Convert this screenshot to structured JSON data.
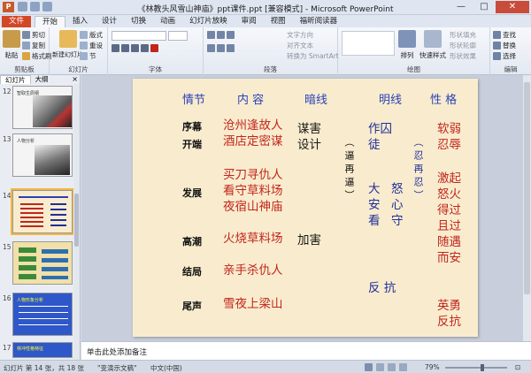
{
  "window": {
    "title": "《林教头风雪山神庙》ppt课件.ppt [兼容模式] - Microsoft PowerPoint",
    "buttons": [
      "—",
      "□",
      "✕"
    ]
  },
  "tabs": [
    "文件",
    "开始",
    "插入",
    "设计",
    "切换",
    "动画",
    "幻灯片放映",
    "审阅",
    "视图",
    "福昕阅读器"
  ],
  "ribbon": {
    "clipboard": {
      "paste": "粘贴",
      "cut": "剪切",
      "copy": "复制",
      "format_painter": "格式刷",
      "label": "剪贴板"
    },
    "slides": {
      "new_slide": "新建幻灯片",
      "layout": "版式",
      "reset": "重设",
      "section": "节",
      "label": "幻灯片"
    },
    "font": {
      "label": "字体"
    },
    "paragraph": {
      "text_direction": "文字方向",
      "align_text": "对齐文本",
      "smartart": "转换为 SmartArt",
      "label": "段落"
    },
    "drawing": {
      "arrange": "排列",
      "quick_styles": "快速样式",
      "shape_fill": "形状填充",
      "shape_outline": "形状轮廓",
      "shape_effects": "形状效果",
      "label": "绘图"
    },
    "editing": {
      "find": "查找",
      "replace": "替换",
      "select": "选择",
      "label": "编辑"
    }
  },
  "left_panel": {
    "tabs": [
      "幻灯片",
      "大纲"
    ],
    "close": "×",
    "slide_numbers": [
      "12",
      "13",
      "14",
      "15",
      "16",
      "17"
    ],
    "thumb_texts": {
      "t12": "智取生辰纲",
      "t13": "人物分析",
      "t16": "人物形象分析",
      "t17": "林冲性格特征"
    },
    "selected": "14"
  },
  "slide": {
    "headers": [
      "情节",
      "内 容",
      "暗线",
      "明线",
      "性 格"
    ],
    "rows": [
      {
        "label": "序幕",
        "content": [
          "沧州逢故人"
        ]
      },
      {
        "label": "开端",
        "content": [
          "酒店定密谋"
        ]
      },
      {
        "label": "发展",
        "content": [
          "买刀寻仇人",
          "看守草料场",
          "夜宿山神庙"
        ]
      },
      {
        "label": "高潮",
        "content": [
          "火烧草料场"
        ]
      },
      {
        "label": "结局",
        "content": [
          "亲手杀仇人"
        ]
      },
      {
        "label": "尾声",
        "content": [
          "雪夜上梁山"
        ]
      }
    ],
    "dark_line": {
      "plot": "谋害",
      "plan": "设计",
      "add_harm": "加害",
      "vertical": "（逼再逼）"
    },
    "bright_line": {
      "prisoner": "作囚",
      "follower": "徒",
      "settle": "大安看",
      "anger": "怒心守",
      "vertical": "（忍再忍）",
      "resist": "反 抗"
    },
    "character": {
      "weak": "软弱",
      "humble": "忍辱",
      "rise": [
        "激起",
        "怒火",
        "得过",
        "且过",
        "随遇",
        "而安"
      ],
      "brave": "英勇",
      "resist": "反抗"
    }
  },
  "notes": "单击此处添加备注",
  "status": {
    "slide": "幻灯片 第 14 张，共 18 张",
    "theme": "\"变演示文稿\"",
    "lang": "中文(中国)",
    "zoom": "79%",
    "zoom_level": 0.6
  },
  "colors": {
    "file_tab": "#d24726",
    "slide_bg": "#f9ecce",
    "header_blue": "#2a41b8",
    "content_red": "#c0261e"
  }
}
